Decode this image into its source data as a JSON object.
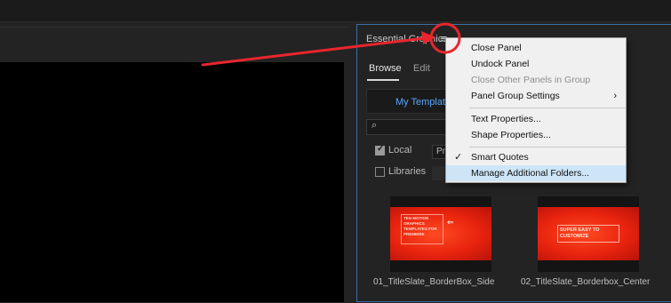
{
  "panel": {
    "title": "Essential Graphics",
    "menu_icon": "≡",
    "tabs": [
      {
        "label": "Browse"
      },
      {
        "label": "Edit"
      }
    ],
    "my_templates_label": "My Templates",
    "search_icon": "search-icon",
    "filters": {
      "local_label": "Local",
      "local_checked": true,
      "local_dropdown_value": "Pr",
      "libraries_label": "Libraries",
      "libraries_checked": false
    },
    "thumbnails": [
      {
        "caption": "01_TitleSlate_BorderBox_Side",
        "overlay_text": "TEN MOTION GRAPHICS TEMPLATES FOR PREMIERE"
      },
      {
        "caption": "02_TitleSlate_Borderbox_Center",
        "overlay_text": "SUPER EASY TO CUSTOMIZE"
      }
    ]
  },
  "context_menu": {
    "items": [
      {
        "label": "Close Panel"
      },
      {
        "label": "Undock Panel"
      },
      {
        "label": "Close Other Panels in Group"
      },
      {
        "label": "Panel Group Settings",
        "submenu_arrow": "›"
      },
      {
        "label": "Text Properties..."
      },
      {
        "label": "Shape Properties..."
      },
      {
        "label": "Smart Quotes",
        "check_mark": "✓"
      },
      {
        "label": "Manage Additional Folders..."
      }
    ]
  },
  "colors": {
    "annotation_red": "#e8262d",
    "panel_focus_border": "#3a6ea5",
    "link_blue": "#5aa6ff",
    "menu_highlight": "#cde5f7"
  }
}
